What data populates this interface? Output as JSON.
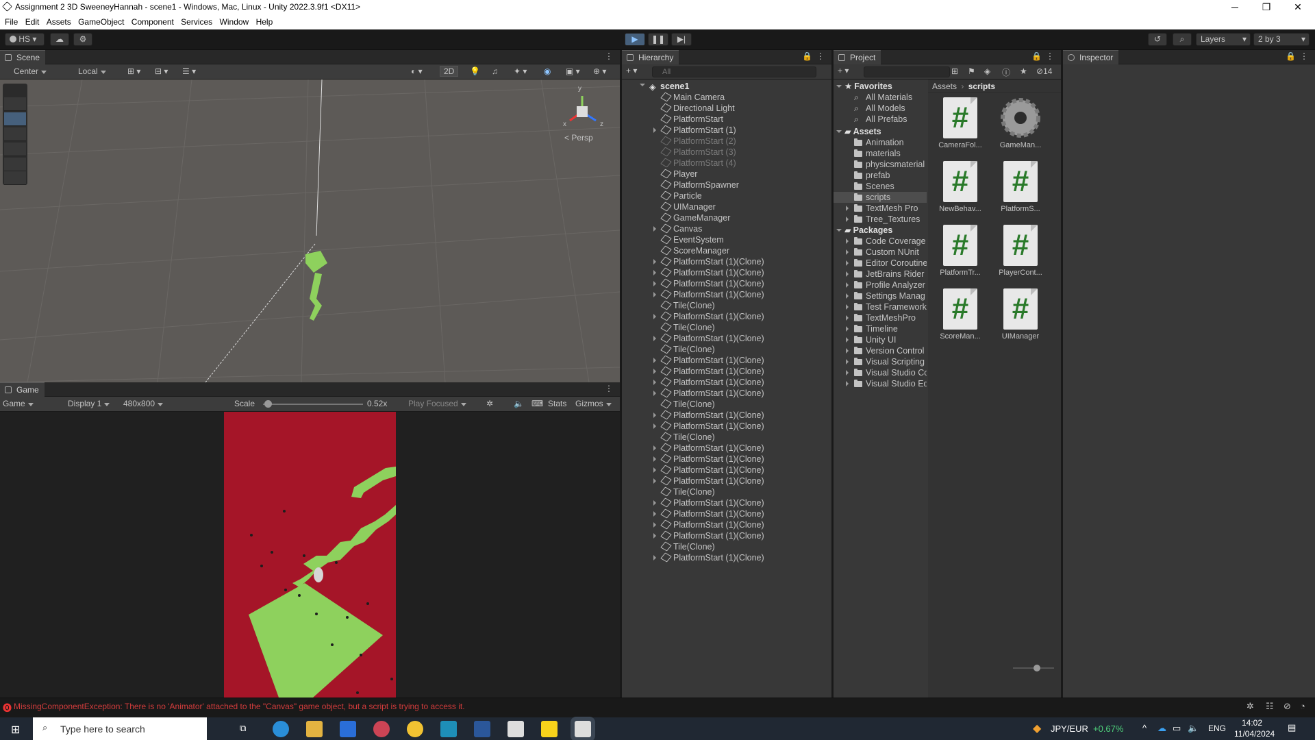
{
  "window": {
    "title": "Assignment 2 3D SweeneyHannah - scene1 - Windows, Mac, Linux - Unity 2022.3.9f1 <DX11>",
    "minimize": "─",
    "restore": "❐",
    "close": "✕"
  },
  "menu": [
    "File",
    "Edit",
    "Assets",
    "GameObject",
    "Component",
    "Services",
    "Window",
    "Help"
  ],
  "toolbar": {
    "account": "HS",
    "layers": "Layers",
    "layout": "2 by 3"
  },
  "scene": {
    "tab": "Scene",
    "pivot": "Center",
    "space": "Local",
    "mode2d": "2D",
    "persp": "< Persp",
    "gizmo_y": "y",
    "gizmo_x": "x",
    "gizmo_z": "z"
  },
  "game": {
    "tab": "Game",
    "view": "Game",
    "display": "Display 1",
    "resolution": "480x800",
    "scale_label": "Scale",
    "scale_value": "0.52x",
    "play_mode": "Play Focused",
    "stats": "Stats",
    "gizmos": "Gizmos",
    "bg_color": "#a51528",
    "platform_color": "#8ed15d",
    "scale_fraction": 0.05
  },
  "hierarchy": {
    "tab": "Hierarchy",
    "search_placeholder": "All",
    "root": "scene1",
    "items": [
      {
        "label": "Main Camera",
        "fold": false,
        "dim": false
      },
      {
        "label": "Directional Light",
        "fold": false,
        "dim": false
      },
      {
        "label": "PlatformStart",
        "fold": false,
        "dim": false
      },
      {
        "label": "PlatformStart (1)",
        "fold": true,
        "dim": false
      },
      {
        "label": "PlatformStart (2)",
        "fold": false,
        "dim": true
      },
      {
        "label": "PlatformStart (3)",
        "fold": false,
        "dim": true
      },
      {
        "label": "PlatformStart (4)",
        "fold": false,
        "dim": true
      },
      {
        "label": "Player",
        "fold": false,
        "dim": false
      },
      {
        "label": "PlatformSpawner",
        "fold": false,
        "dim": false
      },
      {
        "label": "Particle",
        "fold": false,
        "dim": false
      },
      {
        "label": "UIManager",
        "fold": false,
        "dim": false
      },
      {
        "label": "GameManager",
        "fold": false,
        "dim": false
      },
      {
        "label": "Canvas",
        "fold": true,
        "dim": false
      },
      {
        "label": "EventSystem",
        "fold": false,
        "dim": false
      },
      {
        "label": "ScoreManager",
        "fold": false,
        "dim": false
      },
      {
        "label": "PlatformStart (1)(Clone)",
        "fold": true,
        "dim": false
      },
      {
        "label": "PlatformStart (1)(Clone)",
        "fold": true,
        "dim": false
      },
      {
        "label": "PlatformStart (1)(Clone)",
        "fold": true,
        "dim": false
      },
      {
        "label": "PlatformStart (1)(Clone)",
        "fold": true,
        "dim": false
      },
      {
        "label": "Tile(Clone)",
        "fold": false,
        "dim": false
      },
      {
        "label": "PlatformStart (1)(Clone)",
        "fold": true,
        "dim": false
      },
      {
        "label": "Tile(Clone)",
        "fold": false,
        "dim": false
      },
      {
        "label": "PlatformStart (1)(Clone)",
        "fold": true,
        "dim": false
      },
      {
        "label": "Tile(Clone)",
        "fold": false,
        "dim": false
      },
      {
        "label": "PlatformStart (1)(Clone)",
        "fold": true,
        "dim": false
      },
      {
        "label": "PlatformStart (1)(Clone)",
        "fold": true,
        "dim": false
      },
      {
        "label": "PlatformStart (1)(Clone)",
        "fold": true,
        "dim": false
      },
      {
        "label": "PlatformStart (1)(Clone)",
        "fold": true,
        "dim": false
      },
      {
        "label": "Tile(Clone)",
        "fold": false,
        "dim": false
      },
      {
        "label": "PlatformStart (1)(Clone)",
        "fold": true,
        "dim": false
      },
      {
        "label": "PlatformStart (1)(Clone)",
        "fold": true,
        "dim": false
      },
      {
        "label": "Tile(Clone)",
        "fold": false,
        "dim": false
      },
      {
        "label": "PlatformStart (1)(Clone)",
        "fold": true,
        "dim": false
      },
      {
        "label": "PlatformStart (1)(Clone)",
        "fold": true,
        "dim": false
      },
      {
        "label": "PlatformStart (1)(Clone)",
        "fold": true,
        "dim": false
      },
      {
        "label": "PlatformStart (1)(Clone)",
        "fold": true,
        "dim": false
      },
      {
        "label": "Tile(Clone)",
        "fold": false,
        "dim": false
      },
      {
        "label": "PlatformStart (1)(Clone)",
        "fold": true,
        "dim": false
      },
      {
        "label": "PlatformStart (1)(Clone)",
        "fold": true,
        "dim": false
      },
      {
        "label": "PlatformStart (1)(Clone)",
        "fold": true,
        "dim": false
      },
      {
        "label": "PlatformStart (1)(Clone)",
        "fold": true,
        "dim": false
      },
      {
        "label": "Tile(Clone)",
        "fold": false,
        "dim": false
      },
      {
        "label": "PlatformStart (1)(Clone)",
        "fold": true,
        "dim": false
      }
    ]
  },
  "project": {
    "tab": "Project",
    "hidden_count": "14",
    "breadcrumb_root": "Assets",
    "breadcrumb_leaf": "scripts",
    "favorites_label": "Favorites",
    "favorites": [
      "All Materials",
      "All Models",
      "All Prefabs"
    ],
    "assets_label": "Assets",
    "assets": [
      {
        "label": "Animation",
        "fold": false
      },
      {
        "label": "materials",
        "fold": false
      },
      {
        "label": "physicsmaterial",
        "fold": false
      },
      {
        "label": "prefab",
        "fold": false
      },
      {
        "label": "Scenes",
        "fold": false
      },
      {
        "label": "scripts",
        "fold": false,
        "selected": true
      },
      {
        "label": "TextMesh Pro",
        "fold": true
      },
      {
        "label": "Tree_Textures",
        "fold": true
      }
    ],
    "packages_label": "Packages",
    "packages": [
      "Code Coverage",
      "Custom NUnit",
      "Editor Coroutine",
      "JetBrains Rider",
      "Profile Analyzer",
      "Settings Manag",
      "Test Framework",
      "TextMeshPro",
      "Timeline",
      "Unity UI",
      "Version Control",
      "Visual Scripting",
      "Visual Studio Co",
      "Visual Studio Ed"
    ],
    "files": [
      {
        "label": "CameraFol...",
        "kind": "script"
      },
      {
        "label": "GameMan...",
        "kind": "gear"
      },
      {
        "label": "NewBehav...",
        "kind": "script"
      },
      {
        "label": "PlatformS...",
        "kind": "script"
      },
      {
        "label": "PlatformTr...",
        "kind": "script"
      },
      {
        "label": "PlayerCont...",
        "kind": "script"
      },
      {
        "label": "ScoreMan...",
        "kind": "script"
      },
      {
        "label": "UIManager",
        "kind": "script"
      }
    ]
  },
  "inspector": {
    "tab": "Inspector"
  },
  "status": {
    "error": "MissingComponentException: There is no 'Animator' attached to the \"Canvas\" game object, but a script is trying to access it."
  },
  "taskbar": {
    "search_placeholder": "Type here to search",
    "ticker": "JPY/EUR",
    "ticker_change": "+0.67%",
    "lang": "ENG",
    "time": "14:02",
    "date": "11/04/2024"
  }
}
